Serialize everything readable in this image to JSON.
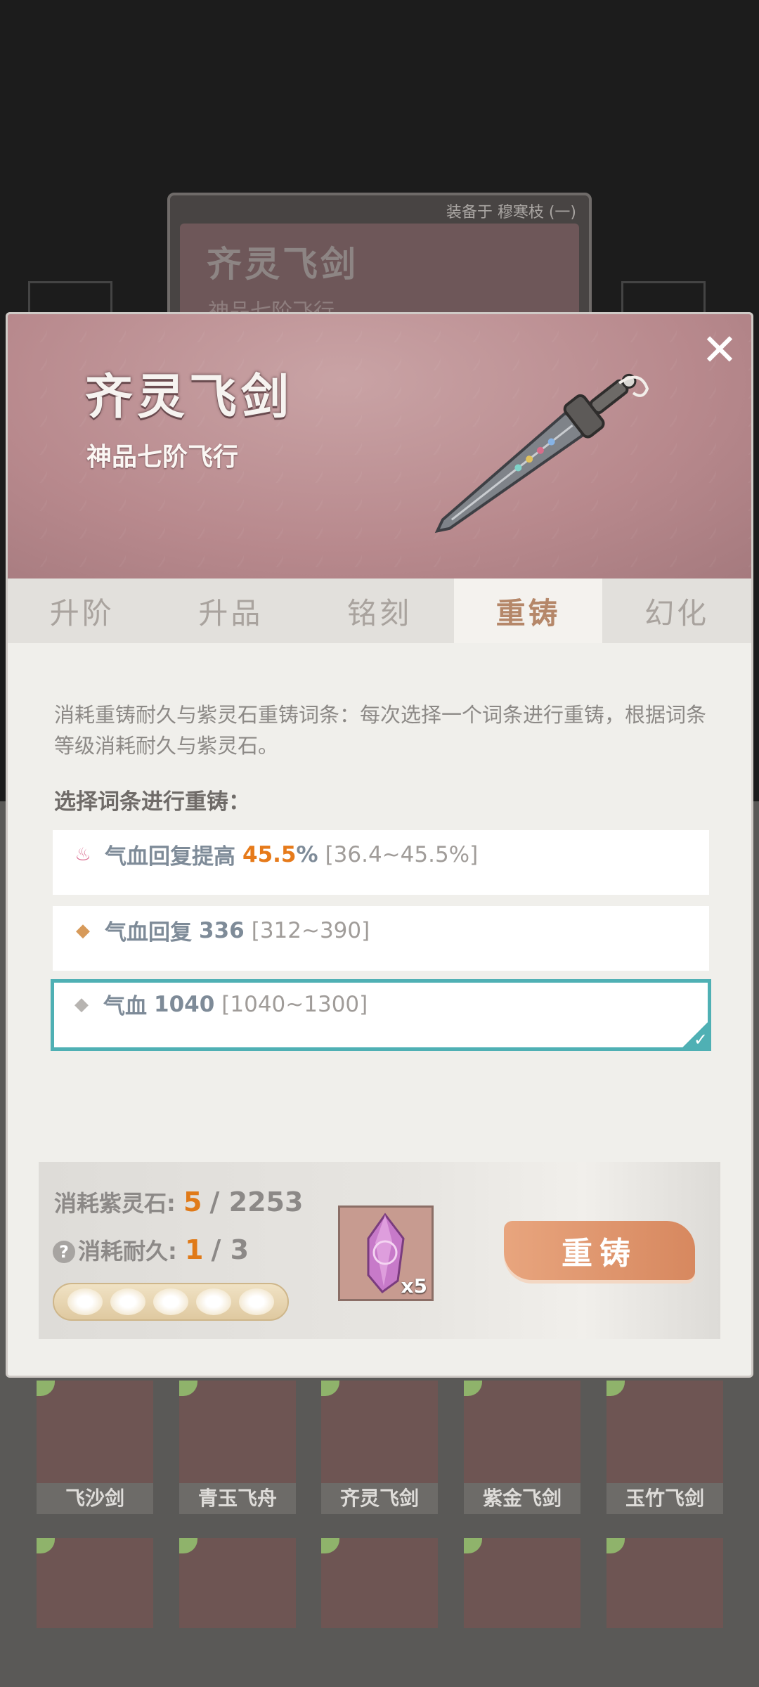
{
  "background_card": {
    "equipped_label": "装备于 穆寒枝 (一)",
    "weapon_name": "齐灵飞剑",
    "weapon_grade": "神品七阶飞行"
  },
  "modal": {
    "weapon_name": "齐灵飞剑",
    "weapon_grade": "神品七阶飞行",
    "close_label": "✕",
    "tabs": [
      {
        "label": "升阶",
        "active": false
      },
      {
        "label": "升品",
        "active": false
      },
      {
        "label": "铭刻",
        "active": false
      },
      {
        "label": "重铸",
        "active": true
      },
      {
        "label": "幻化",
        "active": false
      }
    ],
    "description": "消耗重铸耐久与紫灵石重铸词条：每次选择一个词条进行重铸，根据词条等级消耗耐久与紫灵石。",
    "select_label": "选择词条进行重铸：",
    "affixes": [
      {
        "icon": "flame-icon",
        "name": "气血回复提高",
        "value_num": "45.5",
        "value_unit": "%",
        "range": "[36.4~45.5%]",
        "selected": false,
        "icon_color": "#d96a8e"
      },
      {
        "icon": "diamond-icon",
        "name": "气血回复",
        "value": "336",
        "range": "[312~390]",
        "selected": false,
        "icon_color": "#d79a5a"
      },
      {
        "icon": "diamond-icon",
        "name": "气血",
        "value": "1040",
        "range": "[1040~1300]",
        "selected": true,
        "icon_color": "#b7b4b1"
      }
    ],
    "cost": {
      "stone_label": "消耗紫灵石:",
      "stone_current": "5",
      "stone_total": "/ 2253",
      "durability_label": "消耗耐久:",
      "durability_current": "1",
      "durability_total": "/ 3",
      "durability_pips": 5,
      "gem_count": "x5",
      "recast_button": "重铸"
    }
  },
  "collection": [
    {
      "label": "飞沙剑",
      "art_color": "#6f5051"
    },
    {
      "label": "青玉飞舟",
      "art_color": "#6e5856"
    },
    {
      "label": "齐灵飞剑",
      "art_color": "#6a5553"
    },
    {
      "label": "紫金飞剑",
      "art_color": "#6e5553"
    },
    {
      "label": "玉竹飞剑",
      "art_color": "#6e5553"
    },
    {
      "label": "",
      "art_color": "#6e5553"
    },
    {
      "label": "",
      "art_color": "#6e5553"
    },
    {
      "label": "",
      "art_color": "#6e5553"
    },
    {
      "label": "",
      "art_color": "#6e5553"
    },
    {
      "label": "",
      "art_color": "#6e5553"
    }
  ],
  "colors": {
    "accent_orange": "#e07a18",
    "selected_teal": "#4fb0b4",
    "header_pink": "#b8898d"
  }
}
